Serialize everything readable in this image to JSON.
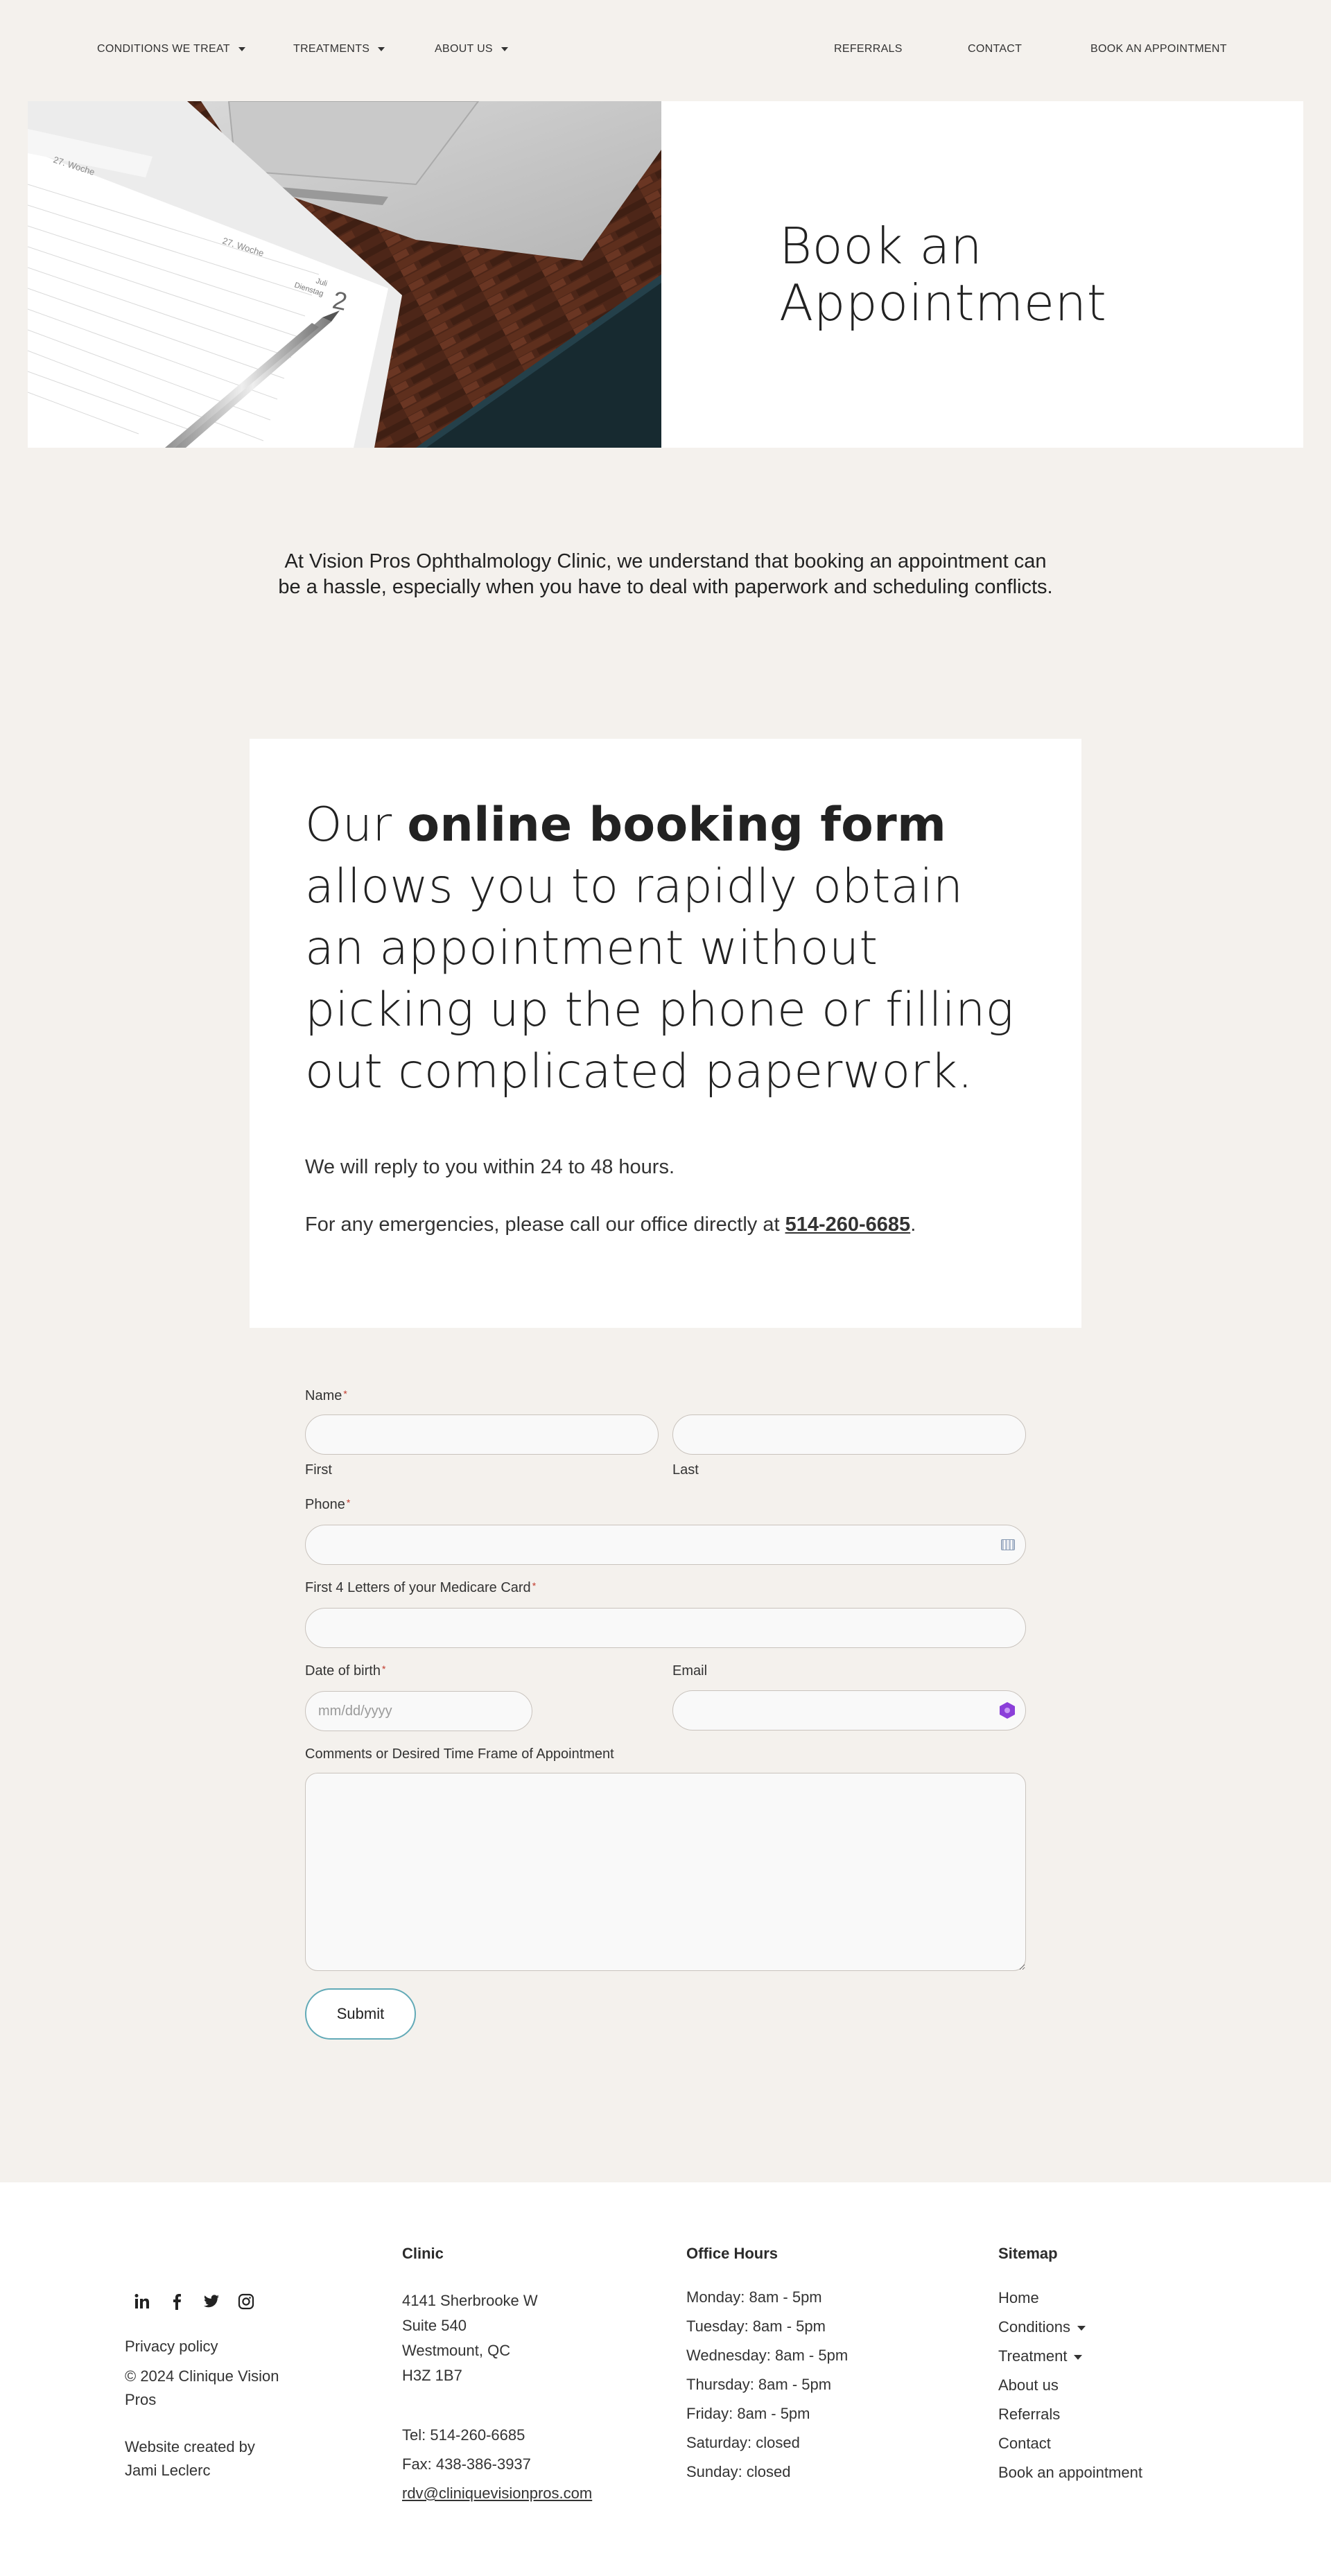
{
  "nav": {
    "left_items": [
      {
        "label": "CONDITIONS WE TREAT"
      },
      {
        "label": "TREATMENTS"
      },
      {
        "label": "ABOUT US"
      }
    ],
    "right_items": [
      {
        "label": "REFERRALS"
      },
      {
        "label": "CONTACT"
      },
      {
        "label": "BOOK AN APPOINTMENT"
      }
    ]
  },
  "hero": {
    "title_line1": "Book an",
    "title_line2": "Appointment",
    "planner_labels": {
      "week1": "27. Woche",
      "week2": "27. Woche",
      "day": "2",
      "month": "Juli",
      "weekday": "Dienstag"
    }
  },
  "intro": {
    "text": "At Vision Pros Ophthalmology Clinic, we understand that booking an appointment can be a hassle, especially when you have to deal with paperwork and scheduling conflicts."
  },
  "card": {
    "heading_pre": "Our ",
    "heading_bold": "online booking form",
    "heading_post": " allows you to rapidly obtain an appointment without picking up the phone or filling out complicated paperwork.",
    "reply_text": "We will reply to you within 24 to 48 hours.",
    "emergency_pre": "For any emergencies, please call our office directly at ",
    "emergency_phone": "514-260-6685",
    "emergency_post": "."
  },
  "form": {
    "name_label": "Name",
    "first_label": "First",
    "last_label": "Last",
    "phone_label": "Phone",
    "medicare_label": "First 4 Letters of your Medicare Card",
    "dob_label": "Date of birth",
    "dob_placeholder": "mm/dd/yyyy",
    "email_label": "Email",
    "comments_label": "Comments or Desired Time Frame of Appointment",
    "required_mark": "*",
    "submit_label": "Submit"
  },
  "footer": {
    "social_icons": [
      "linkedin-icon",
      "facebook-icon",
      "twitter-icon",
      "instagram-icon"
    ],
    "privacy": "Privacy policy",
    "copyright_line1": "© 2024 Clinique Vision",
    "copyright_line2": "Pros",
    "credit_line1": "Website created by",
    "credit_line2": "Jami Leclerc",
    "clinic": {
      "title": "Clinic",
      "address": [
        "4141 Sherbrooke W",
        "Suite 540",
        "Westmount, QC",
        "H3Z 1B7"
      ],
      "tel": "Tel: 514-260-6685",
      "fax": "Fax: 438-386-3937",
      "email": "rdv@cliniquevisionpros.com"
    },
    "hours": {
      "title": "Office Hours",
      "rows": [
        "Monday: 8am - 5pm",
        "Tuesday: 8am - 5pm",
        "Wednesday: 8am - 5pm",
        "Thursday: 8am - 5pm",
        "Friday: 8am - 5pm",
        "Saturday: closed",
        "Sunday: closed"
      ]
    },
    "sitemap": {
      "title": "Sitemap",
      "items": [
        "Home",
        "Conditions",
        "Treatment",
        "About us",
        "Referrals",
        "Contact",
        "Book an appointment"
      ]
    }
  },
  "colors": {
    "page_bg": "#f4f1ed",
    "button_border": "#62aab7",
    "required": "#c0392b"
  }
}
